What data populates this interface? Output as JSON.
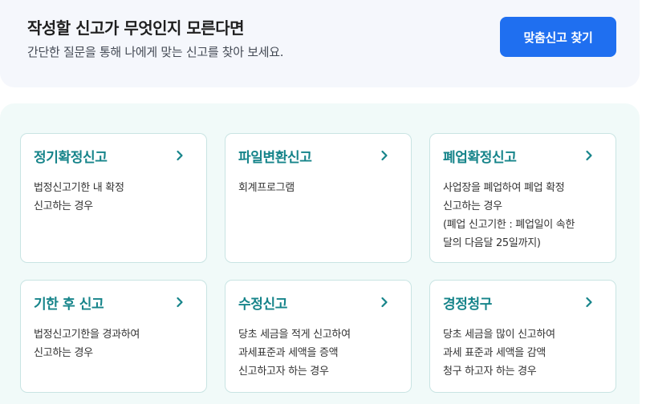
{
  "banner": {
    "title": "작성할 신고가 무엇인지 모른다면",
    "description": "간단한 질문을 통해 나에게 맞는 신고를 찾아 보세요.",
    "button_label": "맞춤신고 찾기"
  },
  "colors": {
    "accent_blue": "#1f6ff0",
    "card_title_teal": "#16848a",
    "card_border": "#c9e4e3",
    "cards_background": "#f1faf9",
    "banner_background": "#f5f7fc"
  },
  "cards": [
    {
      "title": "정기확정신고",
      "lines": [
        "법정신고기한 내 확정",
        "신고하는 경우"
      ],
      "icon": "chevron-right-icon"
    },
    {
      "title": "파일변환신고",
      "lines": [
        "회계프로그램"
      ],
      "icon": "chevron-right-icon"
    },
    {
      "title": "폐업확정신고",
      "lines": [
        "사업장을 폐업하여 폐업 확정",
        "신고하는 경우",
        "(폐업 신고기한 : 폐업일이 속한",
        "달의 다음달 25일까지)"
      ],
      "icon": "chevron-right-icon"
    },
    {
      "title": "기한 후 신고",
      "lines": [
        "법정신고기한을 경과하여",
        "신고하는 경우"
      ],
      "icon": "chevron-right-icon"
    },
    {
      "title": "수정신고",
      "lines": [
        "당초 세금을 적게 신고하여",
        "과세표준과 세액을 증액",
        "신고하고자 하는 경우"
      ],
      "icon": "chevron-right-icon"
    },
    {
      "title": "경정청구",
      "lines": [
        "당초 세금을 많이 신고하여",
        "과세 표준과 세액을 감액",
        "청구 하고자 하는 경우"
      ],
      "icon": "chevron-right-icon"
    }
  ]
}
